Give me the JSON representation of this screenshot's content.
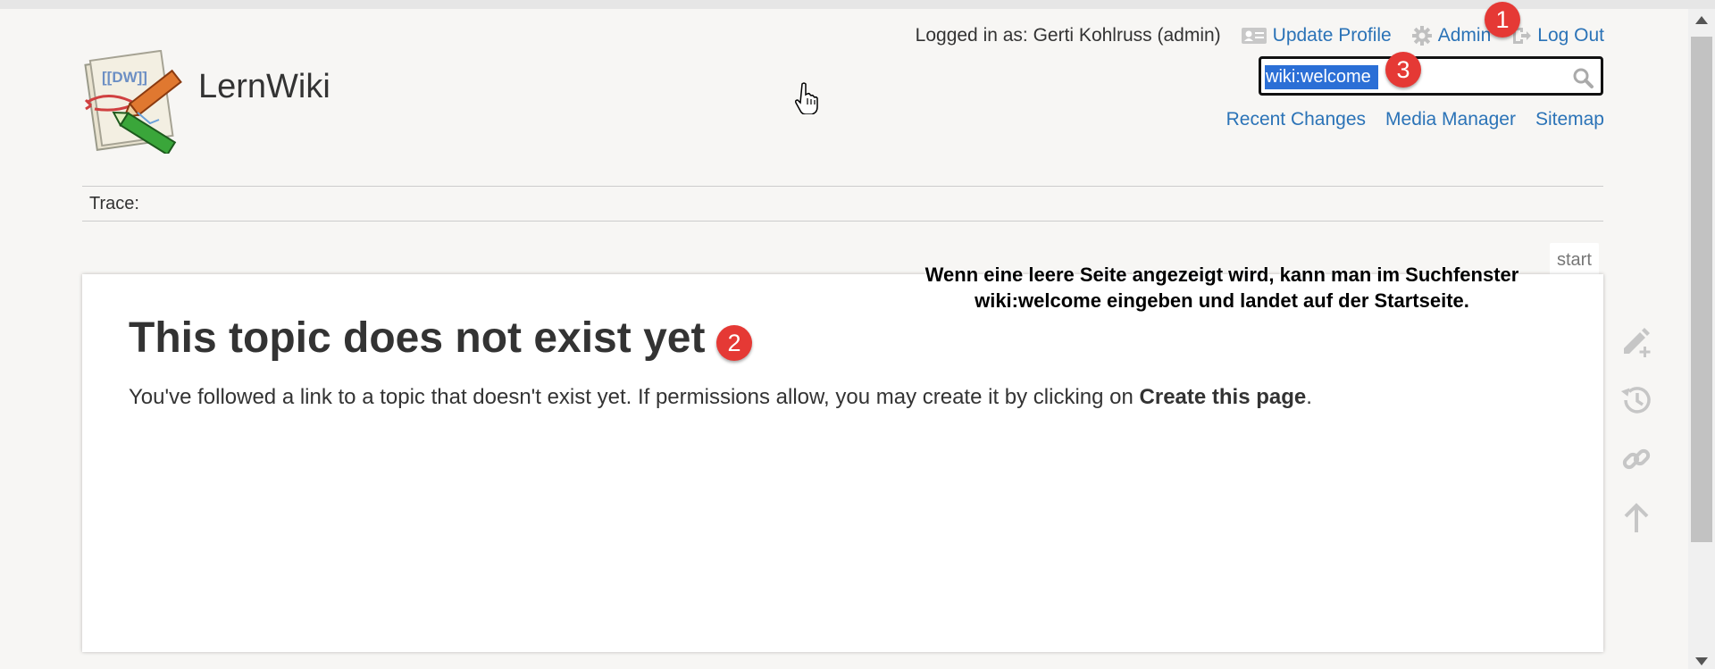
{
  "site": {
    "title": "LernWiki",
    "logo_icon": "dokuwiki-logo-icon"
  },
  "user_tools": {
    "logged_in_text": "Logged in as: Gerti Kohlruss (admin)",
    "update_profile": "Update Profile",
    "admin": "Admin",
    "logout": "Log Out"
  },
  "search": {
    "value": "wiki:welcome",
    "selected_text": "wiki:welcome"
  },
  "site_tools": {
    "recent_changes": "Recent Changes",
    "media_manager": "Media Manager",
    "sitemap": "Sitemap"
  },
  "breadcrumbs": {
    "label": "Trace:"
  },
  "page": {
    "id": "start",
    "heading": "This topic does not exist yet",
    "body_prefix": "You've followed a link to a topic that doesn't exist yet. If permissions allow, you may create it by clicking on ",
    "body_bold": "Create this page",
    "body_suffix": "."
  },
  "annotation": {
    "line1": "Wenn eine leere Seite angezeigt wird, kann man im Suchfenster",
    "line2": "wiki:welcome eingeben und landet auf der Startseite."
  },
  "markers": {
    "m1": "1",
    "m2": "2",
    "m3": "3"
  },
  "page_tools": [
    "create-page-icon",
    "old-revisions-icon",
    "backlinks-icon",
    "back-to-top-icon"
  ],
  "colors": {
    "link": "#2b73b7",
    "marker": "#e53935",
    "selection": "#2b6fd6",
    "background": "#f7f6f4"
  }
}
